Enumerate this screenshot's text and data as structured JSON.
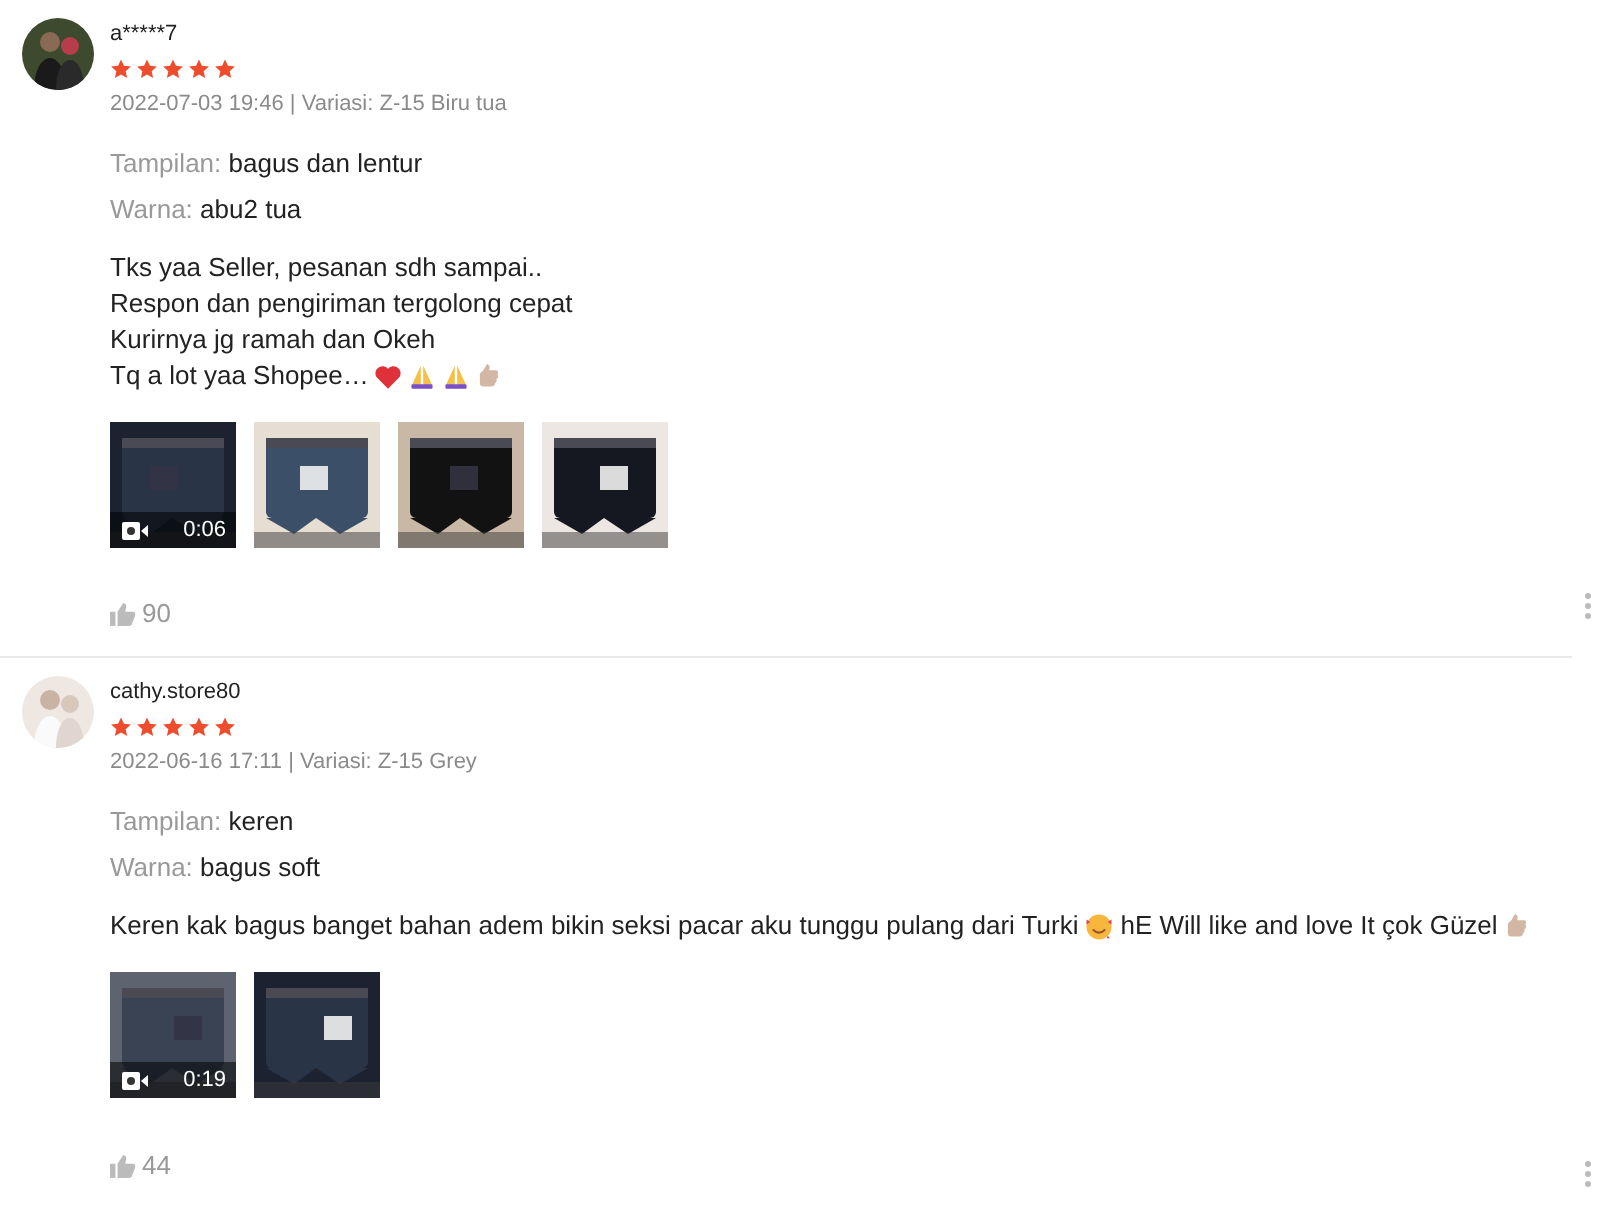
{
  "reviews": [
    {
      "username": "a*****7",
      "stars": 5,
      "date_variant": "2022-07-03 19:46 | Variasi: Z-15 Biru tua",
      "attributes": [
        {
          "label": "Tampilan:",
          "value": "bagus dan lentur"
        },
        {
          "label": "Warna:",
          "value": "abu2 tua"
        }
      ],
      "comment_lines": [
        [
          {
            "kind": "text",
            "text": "Tks yaa Seller, pesanan sdh sampai.."
          }
        ],
        [
          {
            "kind": "text",
            "text": "Respon dan pengiriman tergolong cepat"
          }
        ],
        [
          {
            "kind": "text",
            "text": "Kurirnya jg ramah dan Okeh"
          }
        ],
        [
          {
            "kind": "text",
            "text": "Tq a lot yaa Shopee…"
          },
          {
            "kind": "heart"
          },
          {
            "kind": "pray"
          },
          {
            "kind": "pray"
          },
          {
            "kind": "thumb"
          }
        ]
      ],
      "media": [
        {
          "kind": "video",
          "duration": "0:06"
        },
        {
          "kind": "picture"
        },
        {
          "kind": "picture"
        },
        {
          "kind": "picture"
        }
      ],
      "likes": "90"
    },
    {
      "username": "cathy.store80",
      "stars": 5,
      "date_variant": "2022-06-16 17:11 | Variasi: Z-15 Grey",
      "attributes": [
        {
          "label": "Tampilan:",
          "value": "keren"
        },
        {
          "label": "Warna:",
          "value": "bagus soft"
        }
      ],
      "comment_lines": [
        [
          {
            "kind": "text",
            "text": "Keren kak bagus banget bahan adem bikin seksi pacar aku tunggu pulang dari Turki"
          },
          {
            "kind": "smile"
          },
          {
            "kind": "text",
            "text": "hE Will like and love It çok Güzel"
          },
          {
            "kind": "thumb"
          }
        ]
      ],
      "media": [
        {
          "kind": "video",
          "duration": "0:19"
        },
        {
          "kind": "picture"
        }
      ],
      "likes": "44"
    }
  ]
}
